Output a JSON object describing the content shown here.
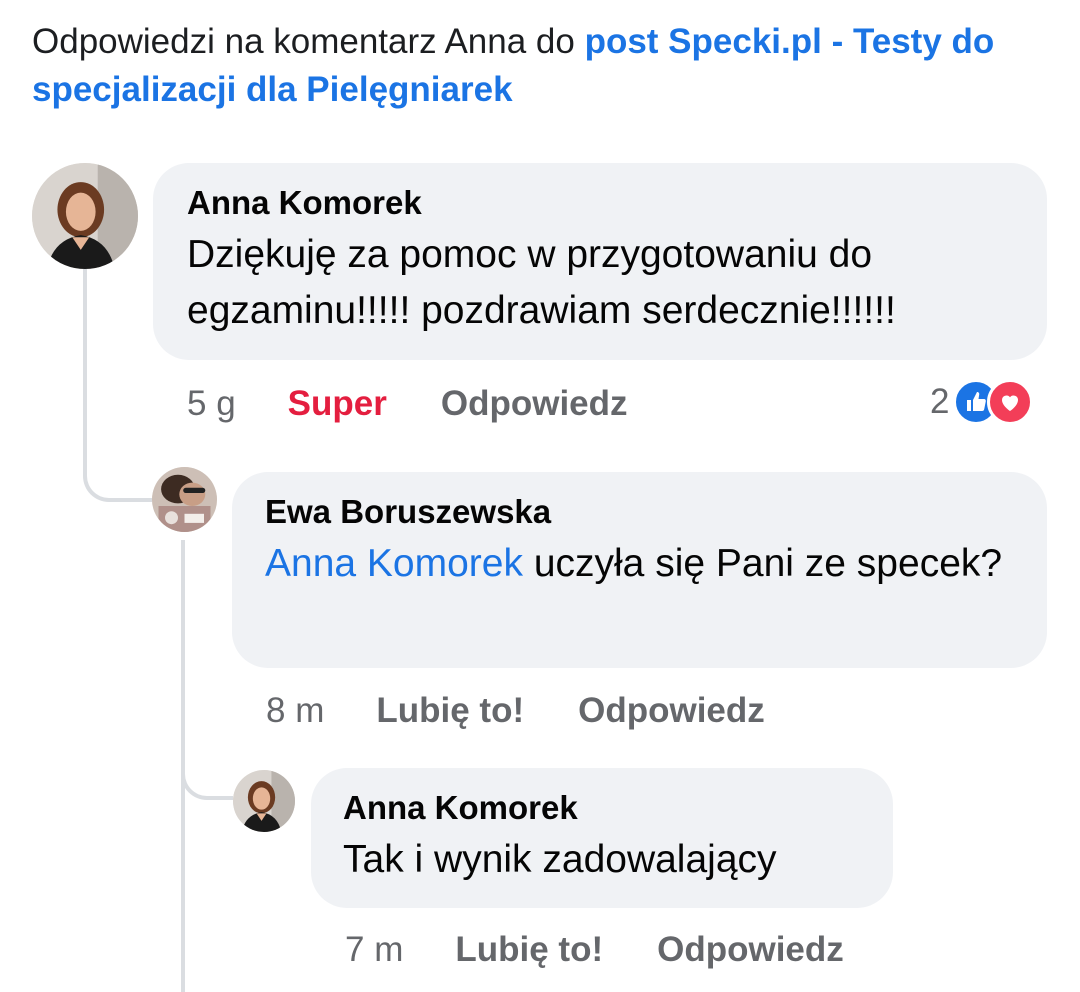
{
  "header": {
    "prefix": "Odpowiedzi na komentarz Anna do ",
    "link": "post Specki.pl - Testy do specjalizacji dla Pielęgniarek"
  },
  "comments": [
    {
      "author": "Anna Komorek",
      "text": "Dziękuję za pomoc w przygotowaniu do egzaminu!!!!! pozdrawiam serdecznie!!!!!!",
      "time": "5 g",
      "reaction_label": "Super",
      "reply_label": "Odpowiedz",
      "reaction_count": "2",
      "reaction_icons": [
        "like-icon",
        "love-icon"
      ]
    },
    {
      "author": "Ewa Boruszewska",
      "mention": "Anna Komorek",
      "text": " uczyła się Pani ze specek?",
      "time": "8 m",
      "like_label": "Lubię to!",
      "reply_label": "Odpowiedz"
    },
    {
      "author": "Anna Komorek",
      "text": "Tak i wynik zadowalający",
      "time": "7 m",
      "like_label": "Lubię to!",
      "reply_label": "Odpowiedz"
    }
  ],
  "colors": {
    "link": "#1b74e4",
    "super": "#e41e3f",
    "action": "#65676b",
    "bubble": "#f0f2f5"
  }
}
